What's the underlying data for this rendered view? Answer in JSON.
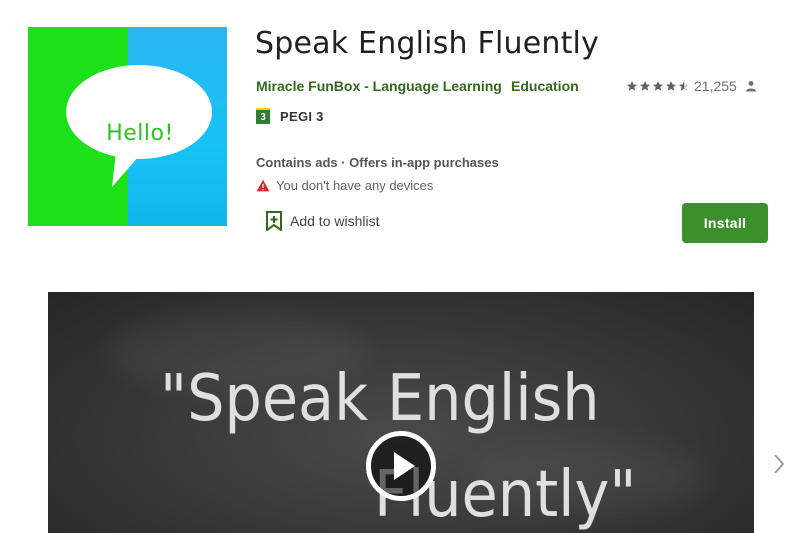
{
  "app": {
    "icon_text": "Hello!",
    "title": "Speak English Fluently",
    "developer": "Miracle FunBox - Language Learning",
    "category": "Education",
    "rating": {
      "stars": 4.5,
      "max_stars": 5,
      "count": "21,255"
    },
    "pegi": {
      "badge": "3",
      "label": "PEGI 3"
    },
    "contains_ads": "Contains ads · Offers in-app purchases",
    "device_warning": "You don't have any devices",
    "wishlist_label": "Add to wishlist",
    "install_label": "Install"
  },
  "media": {
    "line1": "\"Speak English",
    "line2": "Fluently\""
  },
  "icons": [
    "star-icon",
    "person-icon",
    "warning-icon",
    "wishlist-icon",
    "play-icon",
    "chevron-right-icon"
  ],
  "colors": {
    "accent": "#33691e",
    "install": "#3c8f2d",
    "icon_green": "#1ee01a",
    "icon_blue": "#18c2f5",
    "warning": "#d32f2f"
  }
}
